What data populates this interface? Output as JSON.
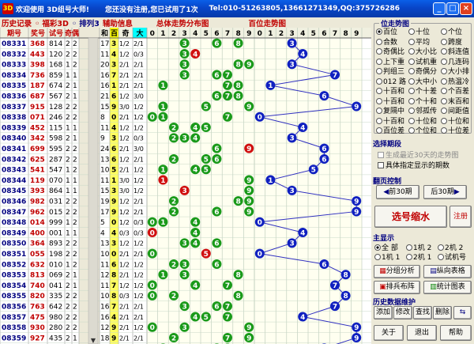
{
  "window": {
    "icon_text": "3D",
    "title_left": "欢迎使用 3D组号大师!",
    "title_mid": "您还没有注册,您已试用了1次",
    "title_right": "Tel:010-51263805,13661271349,QQ:375726286"
  },
  "window_buttons": [
    "_",
    "□",
    "×"
  ],
  "menu": {
    "history": "历史记录",
    "fuhao": "◦ 福彩3D",
    "arrange": "◦ 排列3",
    "aux_info": "辅助信息",
    "overall": "总体走势分布图",
    "hundreds": "百位走势图"
  },
  "table_headers": {
    "period": "期号",
    "prize": "奖号",
    "trial": "试号",
    "odd": "奇",
    "even": "偶",
    "sum": "和",
    "hundred": "百",
    "odd_even": "奇",
    "big_small": "大",
    "digits": [
      "0",
      "1",
      "2",
      "3",
      "4",
      "5",
      "6",
      "7",
      "8",
      "9"
    ]
  },
  "rows": [
    {
      "p": "08331",
      "n": "368",
      "t": "814",
      "o": "2",
      "e": "2",
      "sum": "17",
      "b": "3",
      "oe": "1/2",
      "bs": "2/1"
    },
    {
      "p": "08332",
      "n": "443",
      "t": "120",
      "o": "2",
      "e": "2",
      "sum": "11",
      "b": "4",
      "oe": "1/2",
      "bs": "0/3"
    },
    {
      "p": "08333",
      "n": "398",
      "t": "168",
      "o": "1",
      "e": "2",
      "sum": "20",
      "b": "3",
      "oe": "2/1",
      "bs": "2/1"
    },
    {
      "p": "08334",
      "n": "736",
      "e2": "1",
      "t": "859",
      "o": "1",
      "e": "1",
      "sum": "16",
      "b": "7",
      "oe": "2/1",
      "bs": "2/1"
    },
    {
      "p": "08335",
      "n": "187",
      "t": "674",
      "o": "2",
      "e": "1",
      "sum": "16",
      "b": "1",
      "oe": "2/1",
      "bs": "2/1"
    },
    {
      "p": "08336",
      "n": "687",
      "t": "567",
      "o": "2",
      "e": "1",
      "sum": "21",
      "b": "6",
      "oe": "1/2",
      "bs": "3/0"
    },
    {
      "p": "08337",
      "n": "915",
      "t": "128",
      "o": "2",
      "e": "2",
      "sum": "15",
      "b": "9",
      "oe": "3/0",
      "bs": "1/2"
    },
    {
      "p": "08338",
      "n": "071",
      "t": "246",
      "o": "2",
      "e": "2",
      "sum": "8",
      "b": "0",
      "oe": "2/1",
      "bs": "1/2"
    },
    {
      "p": "08339",
      "n": "452",
      "t": "115",
      "o": "1",
      "e": "1",
      "sum": "11",
      "b": "4",
      "oe": "1/2",
      "bs": "1/2"
    },
    {
      "p": "08340",
      "n": "342",
      "t": "598",
      "o": "2",
      "e": "1",
      "sum": "9",
      "b": "3",
      "oe": "1/2",
      "bs": "0/3"
    },
    {
      "p": "08341",
      "n": "699",
      "t": "595",
      "o": "2",
      "e": "2",
      "sum": "24",
      "b": "6",
      "oe": "2/1",
      "bs": "3/0"
    },
    {
      "p": "08342",
      "n": "625",
      "t": "287",
      "o": "2",
      "e": "2",
      "sum": "13",
      "b": "6",
      "oe": "1/2",
      "bs": "2/1"
    },
    {
      "p": "08343",
      "n": "541",
      "t": "547",
      "o": "1",
      "e": "2",
      "sum": "10",
      "b": "5",
      "oe": "2/1",
      "bs": "1/2"
    },
    {
      "p": "08344",
      "n": "119",
      "t": "070",
      "o": "1",
      "e": "1",
      "sum": "11",
      "b": "1",
      "oe": "3/0",
      "bs": "1/2"
    },
    {
      "p": "08345",
      "n": "393",
      "t": "864",
      "o": "1",
      "e": "1",
      "sum": "15",
      "b": "3",
      "oe": "3/0",
      "bs": "1/2"
    },
    {
      "p": "08346",
      "n": "982",
      "t": "031",
      "o": "2",
      "e": "2",
      "sum": "19",
      "b": "9",
      "oe": "1/2",
      "bs": "2/1"
    },
    {
      "p": "08347",
      "n": "962",
      "t": "015",
      "o": "2",
      "e": "2",
      "sum": "17",
      "b": "9",
      "oe": "1/2",
      "bs": "2/1"
    },
    {
      "p": "08348",
      "n": "014",
      "t": "999",
      "o": "1",
      "e": "2",
      "sum": "5",
      "b": "0",
      "oe": "1/2",
      "bs": "0/3"
    },
    {
      "p": "08349",
      "n": "400",
      "t": "001",
      "o": "1",
      "e": "1",
      "sum": "4",
      "b": "4",
      "oe": "0/3",
      "bs": "0/3"
    },
    {
      "p": "08350",
      "n": "364",
      "t": "893",
      "o": "2",
      "e": "2",
      "sum": "13",
      "b": "3",
      "oe": "1/2",
      "bs": "1/2"
    },
    {
      "p": "08351",
      "n": "055",
      "t": "198",
      "o": "2",
      "e": "2",
      "sum": "10",
      "b": "0",
      "oe": "2/1",
      "bs": "2/1"
    },
    {
      "p": "08352",
      "n": "632",
      "t": "010",
      "o": "1",
      "e": "2",
      "sum": "11",
      "b": "6",
      "oe": "1/2",
      "bs": "1/2"
    },
    {
      "p": "08353",
      "n": "813",
      "t": "069",
      "o": "2",
      "e": "1",
      "sum": "12",
      "b": "8",
      "oe": "2/1",
      "bs": "1/2"
    },
    {
      "p": "08354",
      "n": "740",
      "t": "041",
      "o": "2",
      "e": "1",
      "sum": "11",
      "b": "7",
      "oe": "1/2",
      "bs": "1/2"
    },
    {
      "p": "08355",
      "n": "820",
      "t": "335",
      "o": "2",
      "e": "2",
      "sum": "10",
      "b": "8",
      "oe": "0/3",
      "bs": "1/2"
    },
    {
      "p": "08356",
      "n": "763",
      "t": "642",
      "o": "2",
      "e": "2",
      "sum": "16",
      "b": "7",
      "oe": "2/1",
      "bs": "2/1"
    },
    {
      "p": "08357",
      "n": "475",
      "t": "980",
      "o": "2",
      "e": "2",
      "sum": "16",
      "b": "4",
      "oe": "2/1",
      "bs": "2/1"
    },
    {
      "p": "08358",
      "n": "930",
      "t": "280",
      "o": "2",
      "e": "2",
      "sum": "12",
      "b": "9",
      "oe": "2/1",
      "bs": "1/2"
    },
    {
      "p": "08359",
      "n": "927",
      "t": "435",
      "o": "2",
      "e": "1",
      "sum": "18",
      "b": "9",
      "oe": "2/1",
      "bs": "2/1"
    },
    {
      "p": "08360",
      "n": "671",
      "t": "845",
      "o": "2",
      "e": "1",
      "sum": "14",
      "b": "6",
      "oe": "2/1",
      "bs": "2/1"
    }
  ],
  "right": {
    "pos_title": "位走势图",
    "pos_opts": [
      [
        "百位",
        "十位",
        "个位"
      ],
      [
        "合数",
        "平均",
        "跨度"
      ],
      [
        "奇偶比",
        "大小比",
        "斜连值"
      ],
      [
        "上下重",
        "试机重",
        "几连码"
      ],
      [
        "判组三",
        "奇偶分",
        "大小排"
      ],
      [
        "012 路",
        "大中小",
        "热温冷"
      ],
      [
        "十百和",
        "个十差",
        "个百差"
      ],
      [
        "十百和",
        "个十和",
        "末百和"
      ],
      [
        "复隔中",
        "邻孤传",
        "间距值"
      ],
      [
        "十百和",
        "十位和",
        "十位和"
      ],
      [
        "百位差",
        "个位和",
        "十位差"
      ]
    ],
    "period_title": "选择期段",
    "period_opt1": "生成最近30天的走势图",
    "period_opt2": "具体指定显示的期数",
    "page_title": "翻页控制",
    "prev_btn": "前30期",
    "next_btn": "后30期",
    "shrink_btn": "选号缩水",
    "register_btn": "注册",
    "main_title": "主显示",
    "main_opts": [
      [
        "全 部",
        "1机 2",
        "2机 2"
      ],
      [
        "1机 1",
        "2机 1",
        "试机号"
      ]
    ],
    "analysis_btn": "分组分析",
    "table_btn": "纵向表格",
    "arrange_btn": "排兵布阵",
    "stats_btn": "统计图表",
    "hist_title": "历史数据维护",
    "hist_btns": [
      "添加",
      "修改",
      "查找",
      "删除"
    ],
    "about_btn": "关于",
    "exit_btn": "退出",
    "help_btn": "帮助"
  },
  "colors": {
    "ball_green": "#1a9a1a",
    "ball_blue": "#1020c0",
    "ball_red": "#d01010",
    "header_yellow": "#ffff00",
    "title_blue": "#0845c8"
  }
}
